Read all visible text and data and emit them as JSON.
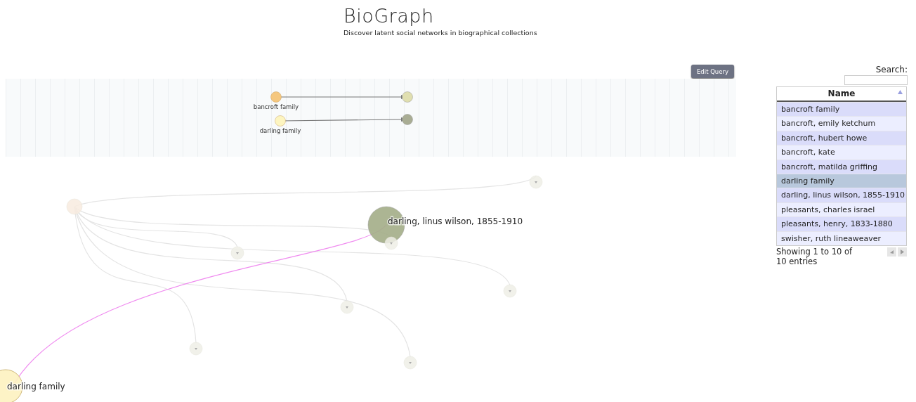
{
  "header": {
    "title": "BioGraph",
    "subtitle": "Discover latent social networks in biographical collections"
  },
  "query": {
    "button": "Edit Query",
    "rows": [
      {
        "label": "bancroft family",
        "source": {
          "color": "#f5c77e"
        },
        "target": {
          "color": "#e0dfb0"
        }
      },
      {
        "label": "darling family",
        "source": {
          "color": "#fdf5c0"
        },
        "target": {
          "color": "#a9ad94"
        }
      }
    ]
  },
  "graph": {
    "nodes": [
      {
        "label": "darling, linus wilson, 1855-1910",
        "color": "#a3ad87",
        "selected": false
      },
      {
        "label": "darling family",
        "color": "#fdf2c0",
        "selected": true
      },
      {
        "color": "#f8ebdf",
        "selected": false
      },
      {
        "color": "#efefe6",
        "selected": false
      },
      {
        "color": "#efefe6",
        "selected": false
      },
      {
        "color": "#efefe6",
        "selected": false
      },
      {
        "color": "#efefe6",
        "selected": false
      },
      {
        "color": "#efefe6",
        "selected": false
      },
      {
        "color": "#efefe6",
        "selected": false
      },
      {
        "color": "#efefe6",
        "selected": false
      }
    ]
  },
  "table": {
    "search_label": "Search:",
    "column": "Name",
    "rows": [
      {
        "name": "bancroft family",
        "selected": false
      },
      {
        "name": "bancroft, emily ketchum",
        "selected": false
      },
      {
        "name": "bancroft, hubert howe",
        "selected": false
      },
      {
        "name": "bancroft, kate",
        "selected": false
      },
      {
        "name": "bancroft, matilda griffing",
        "selected": false
      },
      {
        "name": "darling family",
        "selected": true
      },
      {
        "name": "darling, linus wilson, 1855-1910",
        "selected": false
      },
      {
        "name": "pleasants, charles israel",
        "selected": false
      },
      {
        "name": "pleasants, henry, 1833-1880",
        "selected": false
      },
      {
        "name": "swisher, ruth lineaweaver",
        "selected": false
      }
    ],
    "info": "Showing 1 to 10 of 10 entries"
  }
}
